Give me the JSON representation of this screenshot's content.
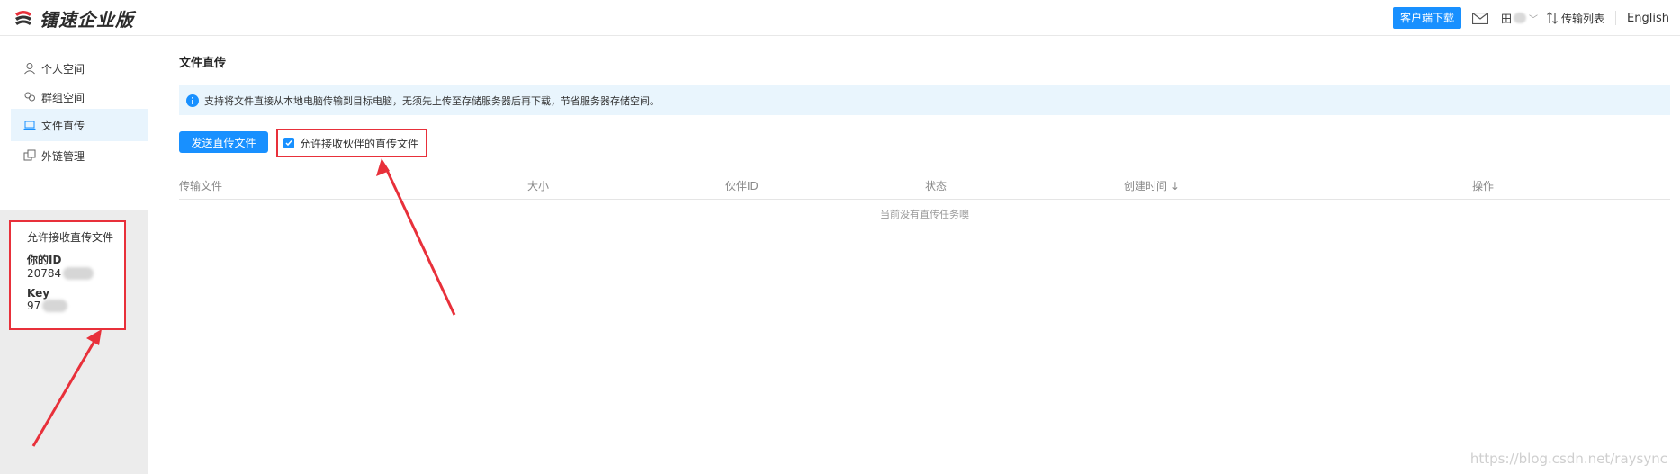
{
  "header": {
    "logo_text": "镭速企业版",
    "download_button": "客户端下载",
    "user_prefix": "田",
    "transfer_list": "传输列表",
    "language": "English",
    "accent_color": "#1890ff"
  },
  "sidebar": {
    "items": [
      {
        "label": "个人空间",
        "icon": "person-icon"
      },
      {
        "label": "群组空间",
        "icon": "group-icon"
      },
      {
        "label": "文件直传",
        "icon": "laptop-icon",
        "active": true
      },
      {
        "label": "外链管理",
        "icon": "link-copy-icon"
      }
    ],
    "info_box": {
      "title": "允许接收直传文件",
      "id_label": "你的ID",
      "id_value": "20784",
      "key_label": "Key",
      "key_value": "97"
    }
  },
  "main": {
    "title": "文件直传",
    "notice": "支持将文件直接从本地电脑传输到目标电脑，无须先上传至存储服务器后再下载，节省服务器存储空间。",
    "send_button": "发送直传文件",
    "allow_checkbox": {
      "label": "允许接收伙伴的直传文件",
      "checked": true
    },
    "table": {
      "columns": [
        "传输文件",
        "大小",
        "伙伴ID",
        "状态",
        "创建时间 ↓",
        "操作"
      ],
      "empty_message": "当前没有直传任务噢"
    }
  },
  "watermark": "https://blog.csdn.net/raysync",
  "highlight_color": "#e8303a"
}
